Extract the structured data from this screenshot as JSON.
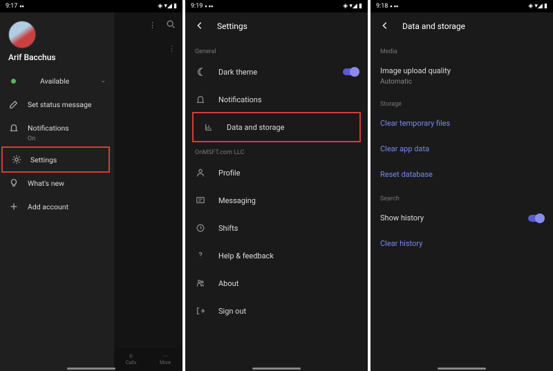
{
  "phone1": {
    "time": "9:17",
    "user_name": "Arif Bacchus",
    "status_text": "Available",
    "menu_status_msg": "Set status message",
    "menu_notifications": "Notifications",
    "menu_notifications_sub": "On",
    "menu_settings": "Settings",
    "menu_whats_new": "What's new",
    "menu_add_account": "Add account",
    "nav_calls": "Calls",
    "nav_more": "More"
  },
  "phone2": {
    "time": "9:19",
    "title": "Settings",
    "section_general": "General",
    "row_dark_theme": "Dark theme",
    "row_notifications": "Notifications",
    "row_data_storage": "Data and storage",
    "section_org": "OnMSFT.com LLC",
    "row_profile": "Profile",
    "row_messaging": "Messaging",
    "row_shifts": "Shifts",
    "row_help": "Help & feedback",
    "row_about": "About",
    "row_sign_out": "Sign out"
  },
  "phone3": {
    "time": "9:18",
    "title": "Data and storage",
    "section_media": "Media",
    "row_image_quality": "Image upload quality",
    "row_image_quality_val": "Automatic",
    "section_storage": "Storage",
    "row_clear_temp": "Clear temporary files",
    "row_clear_app": "Clear app data",
    "row_reset_db": "Reset database",
    "section_search": "Search",
    "row_show_history": "Show history",
    "row_clear_history": "Clear history"
  }
}
